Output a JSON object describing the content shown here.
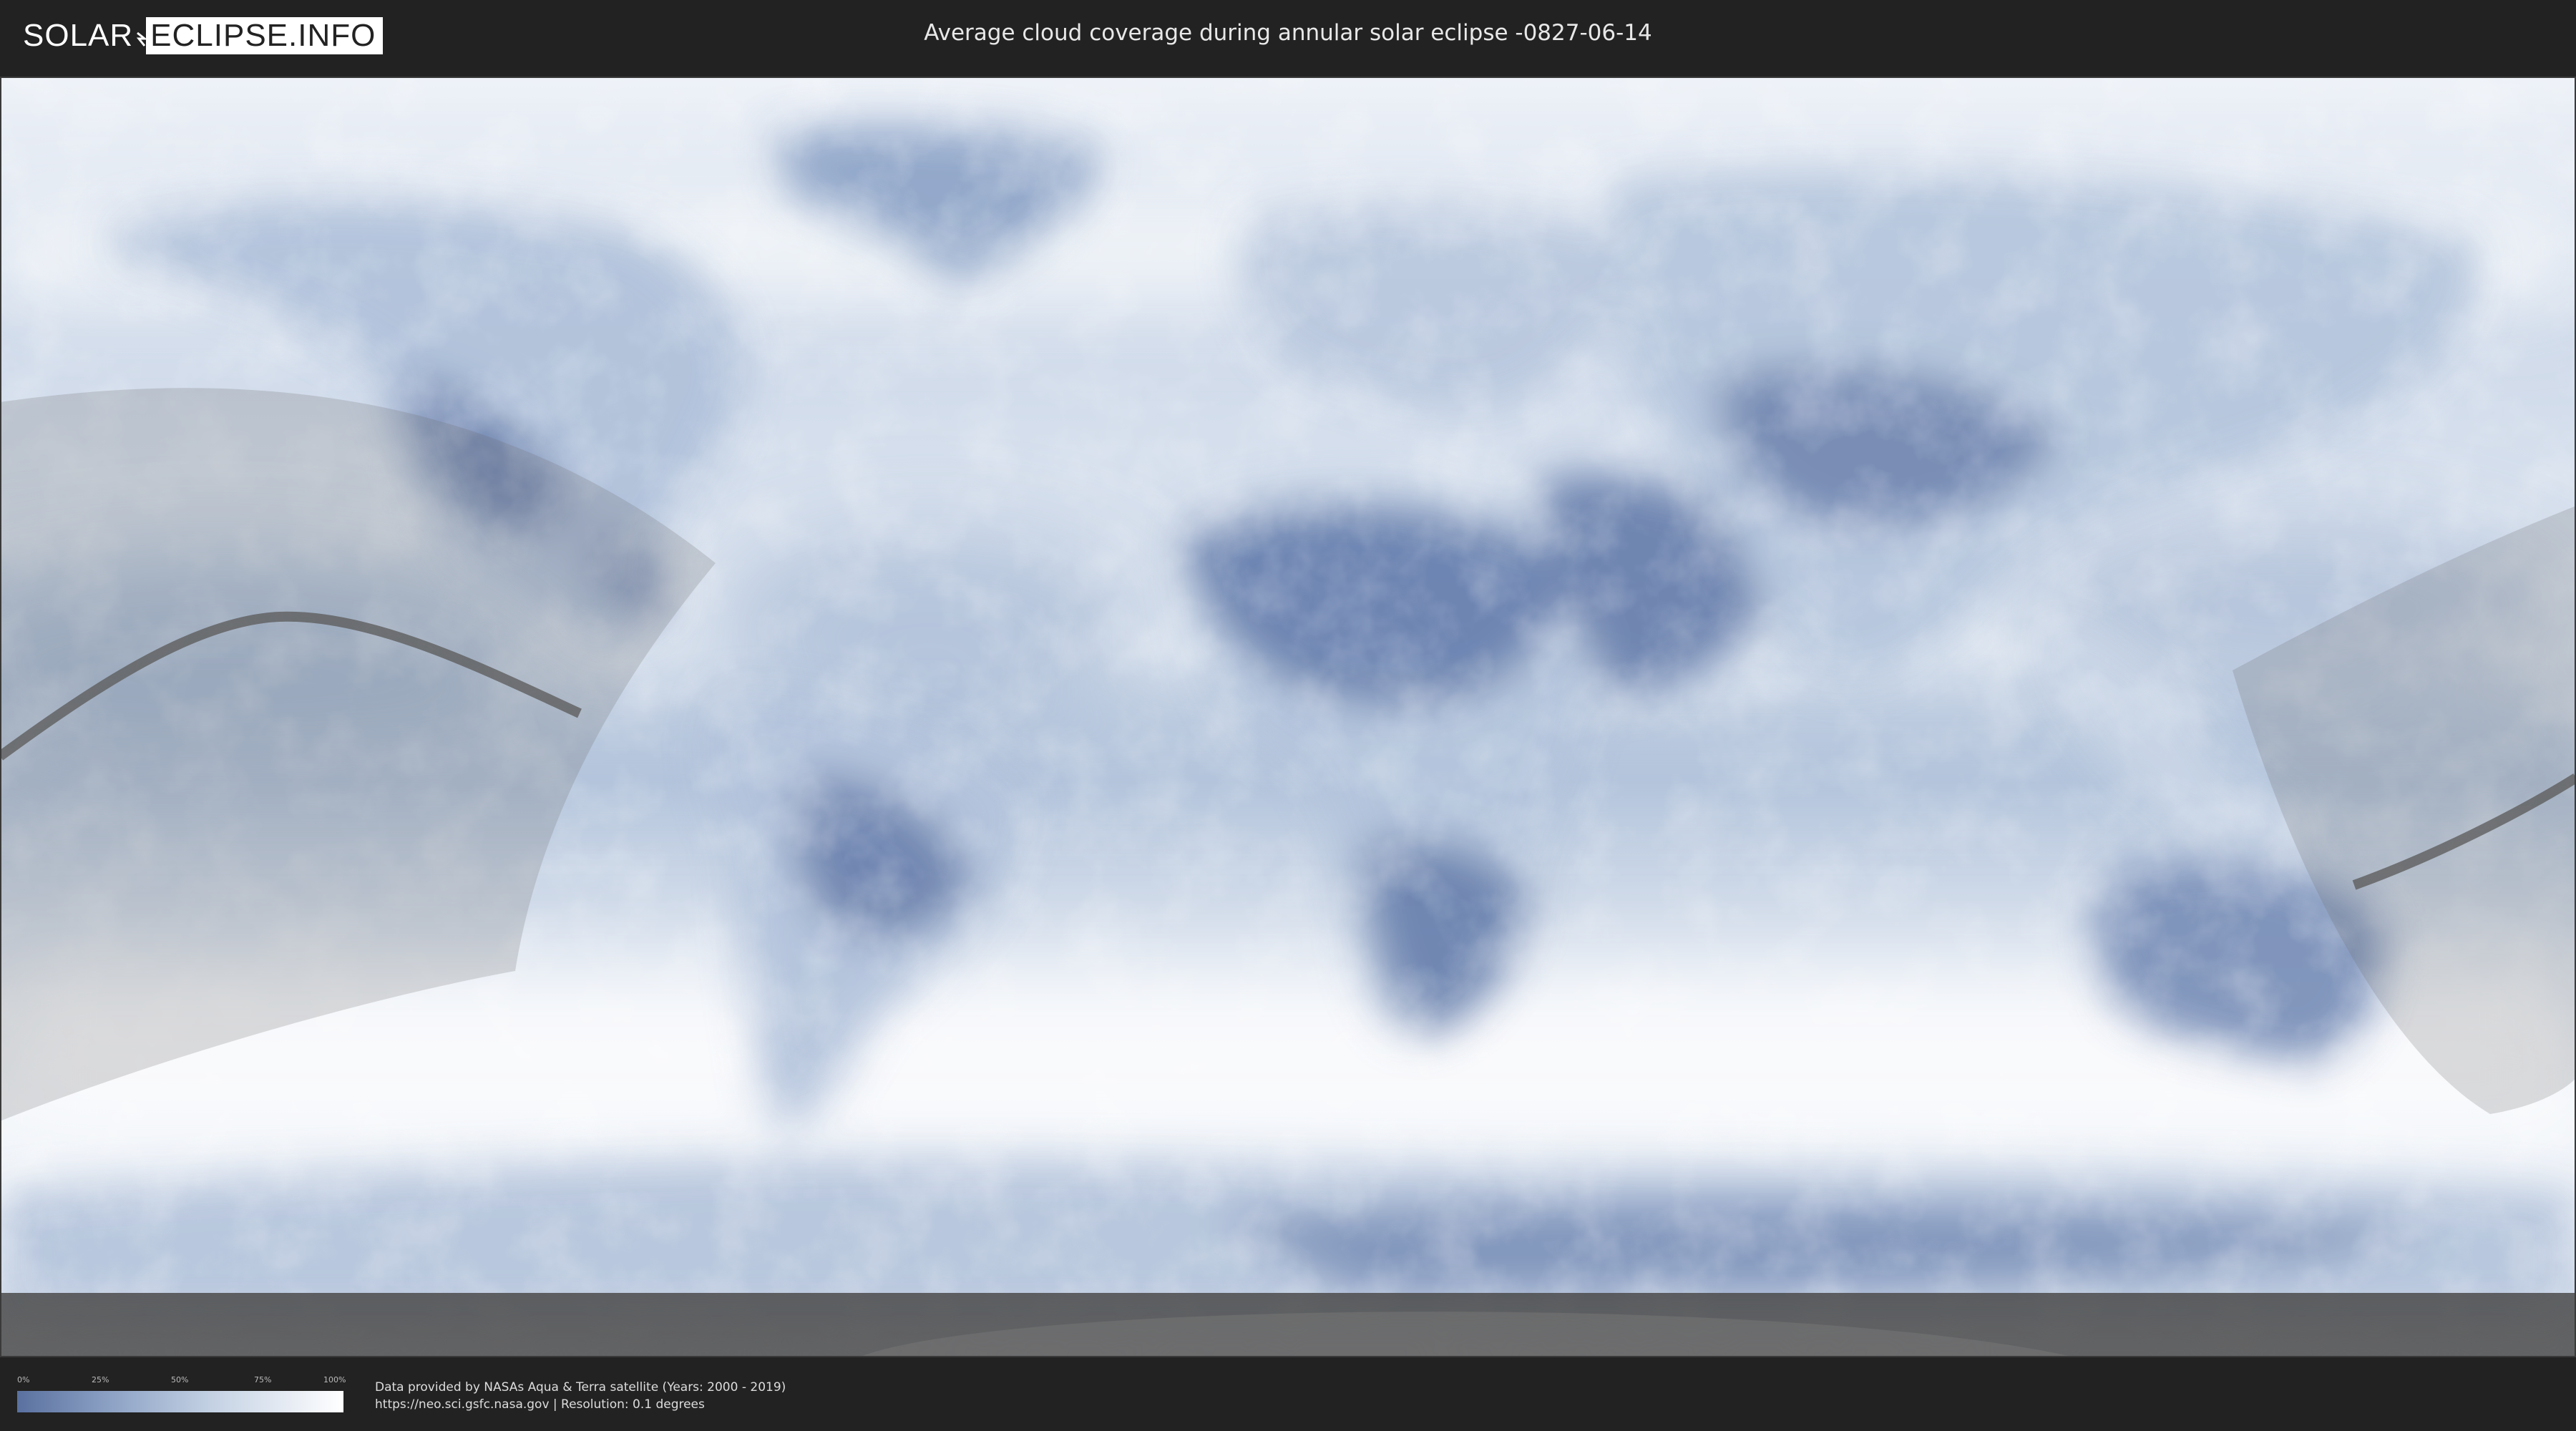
{
  "header": {
    "logo_left": "SOLAR",
    "logo_right": "ECLIPSE.INFO",
    "title": "Average cloud coverage during annular solar eclipse -0827-06-14"
  },
  "legend": {
    "ticks": [
      "0%",
      "25%",
      "50%",
      "75%",
      "100%"
    ],
    "colors": {
      "low": "#5a71a0",
      "high": "#ffffff"
    }
  },
  "footer": {
    "credit_line1": "Data provided by NASAs Aqua & Terra satellite (Years: 2000 - 2019)",
    "credit_line2": "https://neo.sci.gsfc.nasa.gov | Resolution: 0.1 degrees"
  },
  "map": {
    "projection": "equirectangular",
    "ocean_color": "#dfe7f1",
    "clear_sky_color": "#6d82ad",
    "eclipse_path_color": "#6b6b6b",
    "umbra_line_color": "#5e5e5e"
  }
}
